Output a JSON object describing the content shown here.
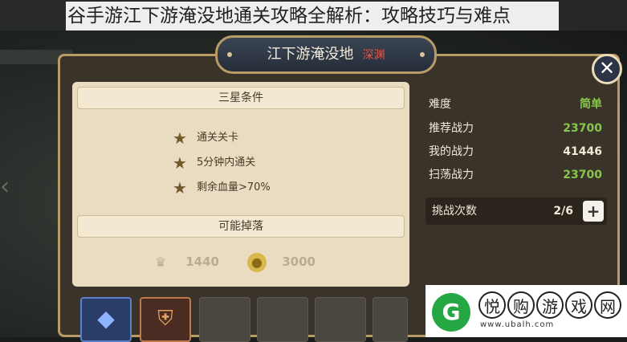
{
  "overlay_title": "谷手游江下游淹没地通关攻略全解析：攻略技巧与难点",
  "dialog": {
    "title": "江下游淹没地",
    "tag": "深渊",
    "close_symbol": "✕"
  },
  "stars_section": {
    "header": "三星条件",
    "conditions": [
      "通关关卡",
      "5分钟内通关",
      "剩余血量>70%"
    ]
  },
  "drops_section": {
    "header": "可能掉落",
    "exp_value": "1440",
    "gold_value": "3000"
  },
  "stats": [
    {
      "label": "难度",
      "value": "简单",
      "color": "#86c64a"
    },
    {
      "label": "推荐战力",
      "value": "23700",
      "color": "#86c64a"
    },
    {
      "label": "我的战力",
      "value": "41446",
      "color": "#f1e9d6"
    },
    {
      "label": "扫荡战力",
      "value": "23700",
      "color": "#86c64a"
    }
  ],
  "attempts": {
    "label": "挑战次数",
    "value": "2/6",
    "plus": "+"
  },
  "watermark": {
    "chars": [
      "悦",
      "购",
      "游",
      "戏",
      "网"
    ],
    "url": "www.ubalh.com"
  },
  "colors": {
    "panel_border": "#b99b66",
    "tag_red": "#e0574a",
    "value_green": "#86c64a",
    "watermark_green": "#25a844"
  }
}
